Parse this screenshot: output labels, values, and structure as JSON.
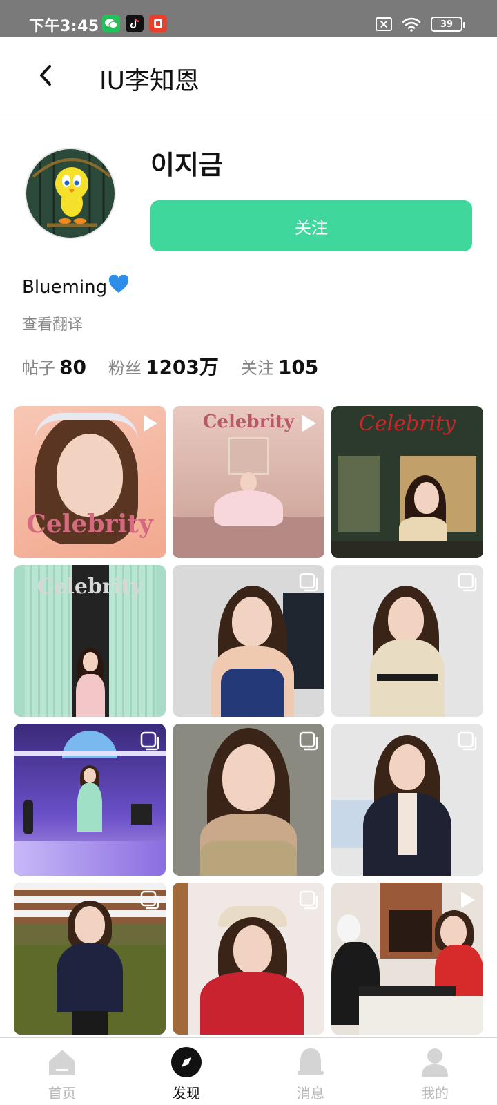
{
  "status_bar": {
    "time": "下午3:45",
    "battery": "39",
    "app_icons": [
      "wechat-icon",
      "tiktok-icon",
      "shopping-app-icon"
    ]
  },
  "header": {
    "title": "IU李知恩",
    "back_icon": "chevron-left-icon"
  },
  "profile": {
    "username": "이지금",
    "follow_label": "关注",
    "bio": "Blueming",
    "bio_emoji": "💙",
    "translate_label": "查看翻译",
    "avatar_icon": "cartoon-bird-avatar"
  },
  "stats": [
    {
      "label": "帖子",
      "value": "80"
    },
    {
      "label": "粉丝",
      "value": "1203万"
    },
    {
      "label": "关注",
      "value": "105"
    }
  ],
  "posts": [
    {
      "type": "video",
      "caption": "Celebrity"
    },
    {
      "type": "video",
      "caption": "Celebrity"
    },
    {
      "type": "image",
      "caption": "Celebrity"
    },
    {
      "type": "image",
      "caption": "Celebrity"
    },
    {
      "type": "multi-image",
      "caption": ""
    },
    {
      "type": "multi-image",
      "caption": ""
    },
    {
      "type": "multi-image",
      "caption": ""
    },
    {
      "type": "multi-image",
      "caption": ""
    },
    {
      "type": "multi-image",
      "caption": ""
    },
    {
      "type": "multi-image",
      "caption": ""
    },
    {
      "type": "multi-image",
      "caption": ""
    },
    {
      "type": "video",
      "caption": ""
    }
  ],
  "bottom_nav": [
    {
      "label": "首页",
      "icon": "home-icon",
      "active": false
    },
    {
      "label": "发现",
      "icon": "compass-icon",
      "active": true
    },
    {
      "label": "消息",
      "icon": "bell-icon",
      "active": false
    },
    {
      "label": "我的",
      "icon": "user-icon",
      "active": false
    }
  ],
  "colors": {
    "accent": "#3fd79c",
    "status_bar": "#7a7a7a",
    "muted_text": "#888888",
    "bio_heart": "#2d8de8"
  }
}
